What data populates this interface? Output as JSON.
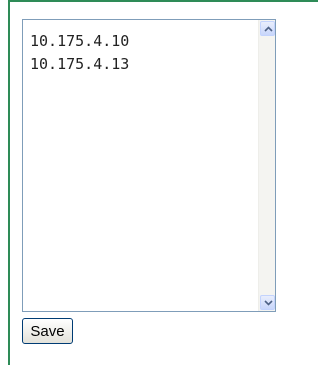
{
  "ip_list": {
    "lines": "10.175.4.10\n10.175.4.13"
  },
  "actions": {
    "save_label": "Save"
  },
  "colors": {
    "frame_border": "#2e8b57",
    "textarea_border": "#7f9db9",
    "button_border": "#003c74"
  },
  "icons": {
    "scroll_up": "chevron-up-icon",
    "scroll_down": "chevron-down-icon"
  }
}
